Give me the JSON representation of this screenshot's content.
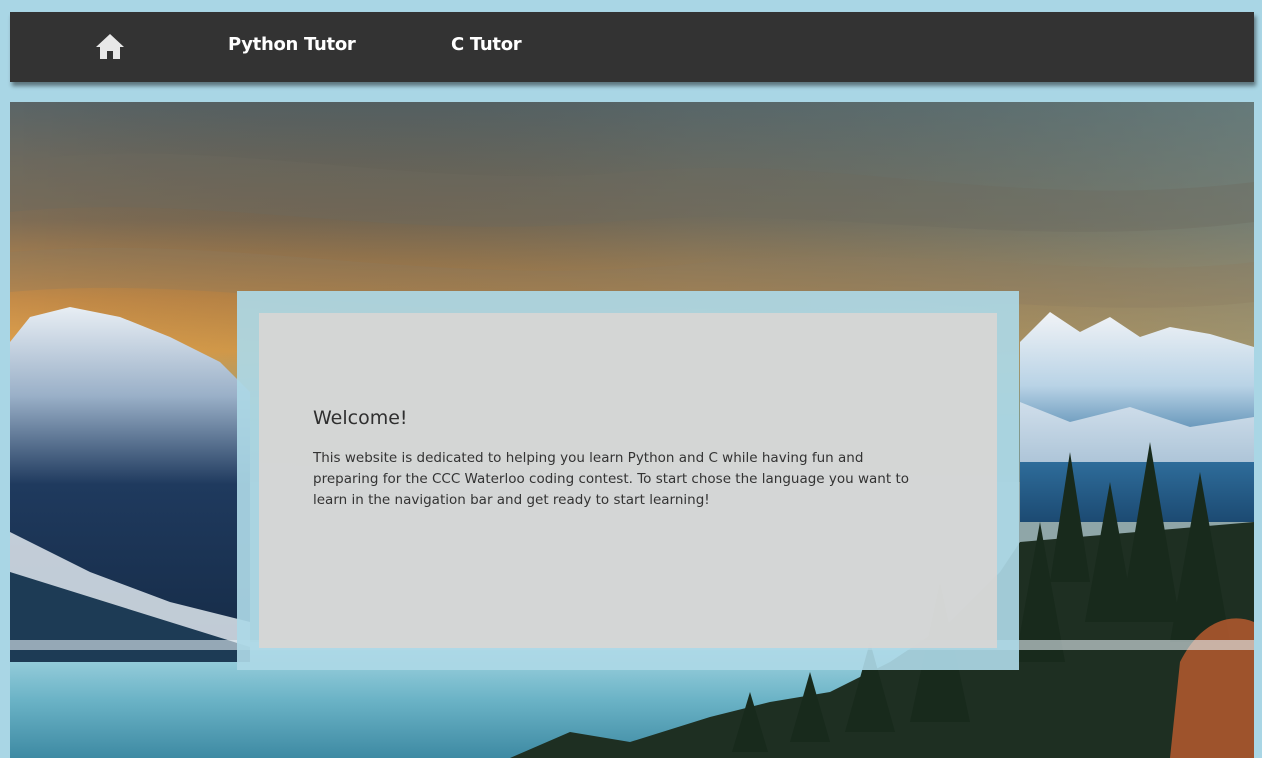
{
  "nav": {
    "home_icon": "home-icon",
    "links": [
      {
        "label": "Python Tutor"
      },
      {
        "label": "C Tutor"
      }
    ]
  },
  "hero": {
    "background": "mountain-landscape"
  },
  "welcome": {
    "title": "Welcome!",
    "body": "This website is dedicated to helping you learn Python and C while having fun and preparing for the CCC Waterloo coding contest. To start chose the language you want to learn in the navigation bar and get ready to start learning!"
  },
  "colors": {
    "page_background": "#a9d6e5",
    "navbar": "#333333",
    "nav_text": "#ffffff",
    "panel_frame": "#add8e6",
    "panel_body": "#dad6d4"
  }
}
